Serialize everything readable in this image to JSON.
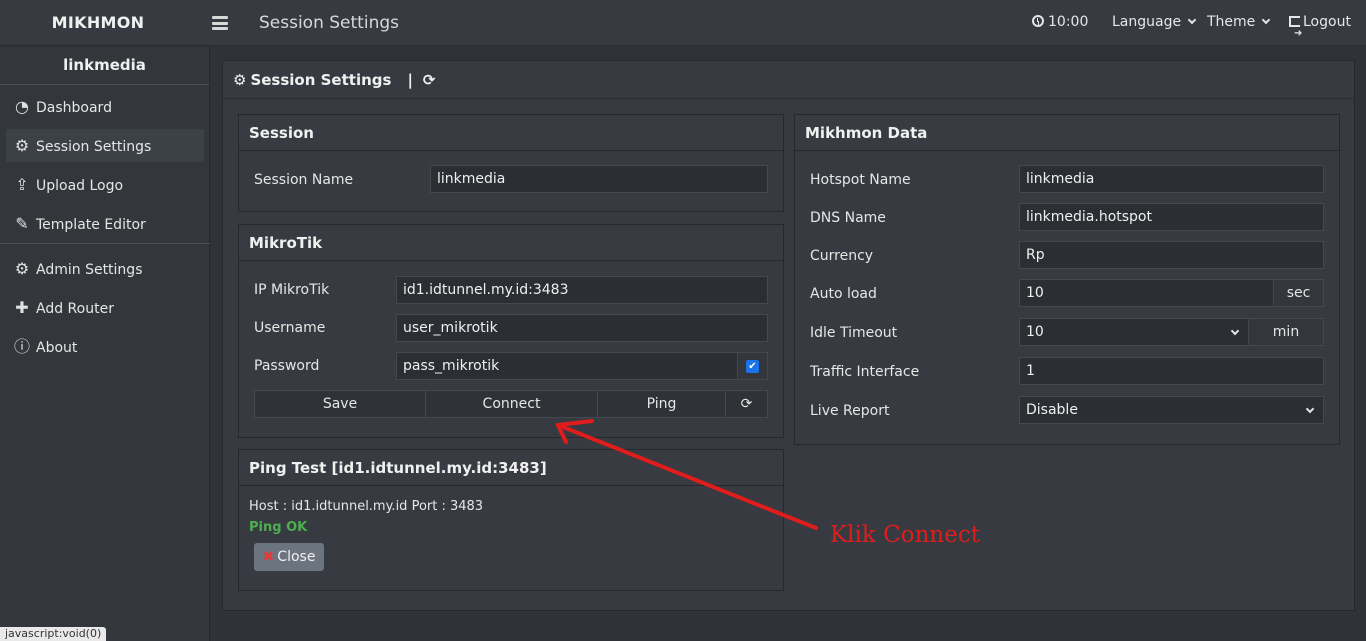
{
  "app": {
    "brand": "MIKHMON",
    "page_title": "Session Settings"
  },
  "topbar": {
    "time": "10:00",
    "language": "Language",
    "theme": "Theme",
    "logout": "Logout"
  },
  "sidebar": {
    "user": "linkmedia",
    "items": [
      {
        "label": "Dashboard",
        "icon": "dashboard-icon"
      },
      {
        "label": "Session Settings",
        "icon": "gear-icon"
      },
      {
        "label": "Upload Logo",
        "icon": "upload-icon"
      },
      {
        "label": "Template Editor",
        "icon": "edit-icon"
      },
      {
        "label": "Admin Settings",
        "icon": "gear-icon"
      },
      {
        "label": "Add Router",
        "icon": "plus-icon"
      },
      {
        "label": "About",
        "icon": "info-icon"
      }
    ]
  },
  "status_url": "javascript:void(0)",
  "main": {
    "title": "Session Settings",
    "separator": "|"
  },
  "session": {
    "title": "Session",
    "name_label": "Session Name",
    "name_value": "linkmedia"
  },
  "mikrotik": {
    "title": "MikroTik",
    "ip_label": "IP MikroTik",
    "ip_value": "id1.idtunnel.my.id:3483",
    "user_label": "Username",
    "user_value": "user_mikrotik",
    "pass_label": "Password",
    "pass_value": "pass_mikrotik",
    "save": "Save",
    "connect": "Connect",
    "ping": "Ping"
  },
  "ping_test": {
    "title": "Ping Test [id1.idtunnel.my.id:3483]",
    "host_line": "Host : id1.idtunnel.my.id Port : 3483",
    "result": "Ping OK",
    "close": "Close"
  },
  "mikhmon_data": {
    "title": "Mikhmon Data",
    "hotspot_label": "Hotspot Name",
    "hotspot_value": "linkmedia",
    "dns_label": "DNS Name",
    "dns_value": "linkmedia.hotspot",
    "currency_label": "Currency",
    "currency_value": "Rp",
    "autoload_label": "Auto load",
    "autoload_value": "10",
    "autoload_unit": "sec",
    "idle_label": "Idle Timeout",
    "idle_value": "10",
    "idle_unit": "min",
    "traffic_label": "Traffic Interface",
    "traffic_value": "1",
    "live_label": "Live Report",
    "live_value": "Disable"
  },
  "annotation": {
    "text": "Klik Connect",
    "color": "#e01c1c"
  }
}
